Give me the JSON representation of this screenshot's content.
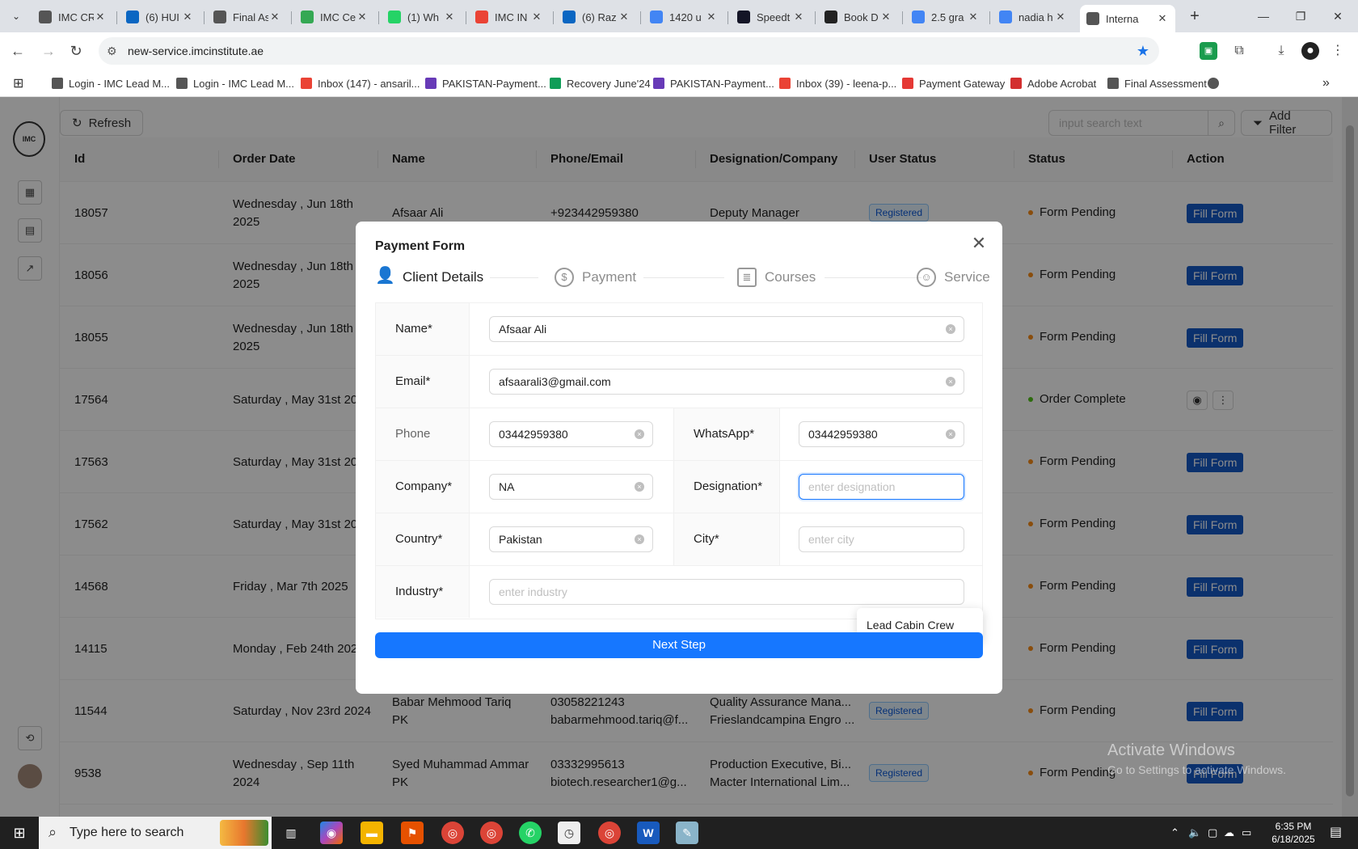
{
  "browser": {
    "tabs": [
      {
        "label": "IMC CR",
        "color": "#555555"
      },
      {
        "label": "(6) HUI",
        "color": "#0a66c2"
      },
      {
        "label": "Final As",
        "color": "#555555"
      },
      {
        "label": "IMC Ce",
        "color": "#34a853"
      },
      {
        "label": "(1) Wh",
        "color": "#25d366"
      },
      {
        "label": "IMC IN",
        "color": "#ea4335"
      },
      {
        "label": "(6) Raz",
        "color": "#0a66c2"
      },
      {
        "label": "1420 u",
        "color": "#4285f4"
      },
      {
        "label": "Speedt",
        "color": "#141526"
      },
      {
        "label": "Book D",
        "color": "#222222"
      },
      {
        "label": "2.5 gra",
        "color": "#4285f4"
      },
      {
        "label": "nadia h",
        "color": "#4285f4"
      },
      {
        "label": "Interna",
        "color": "#555555",
        "active": true
      }
    ],
    "url": "new-service.imcinstitute.ae",
    "bookmarks": [
      {
        "label": "Login - IMC Lead M...",
        "color": "#555555"
      },
      {
        "label": "Login - IMC Lead M...",
        "color": "#555555"
      },
      {
        "label": "Inbox (147) - ansaril...",
        "color": "#ea4335"
      },
      {
        "label": "PAKISTAN-Payment...",
        "color": "#673ab7"
      },
      {
        "label": "Recovery June'24",
        "color": "#0f9d58"
      },
      {
        "label": "PAKISTAN-Payment...",
        "color": "#673ab7"
      },
      {
        "label": "Inbox (39) - leena-p...",
        "color": "#ea4335"
      },
      {
        "label": "Payment Gateway",
        "color": "#e53935"
      },
      {
        "label": "Adobe Acrobat",
        "color": "#d32f2f"
      },
      {
        "label": "Final Assessment",
        "color": "#555555"
      }
    ]
  },
  "sidebar": {
    "logo_text": "IMC"
  },
  "toolbar": {
    "refresh_label": "Refresh",
    "search_placeholder": "input search text",
    "add_filter_label": "Add Filter"
  },
  "table": {
    "columns": [
      "Id",
      "Order Date",
      "Name",
      "Phone/Email",
      "Designation/Company",
      "User Status",
      "Status",
      "Action"
    ],
    "rows": [
      {
        "id": "18057",
        "date1": "Wednesday , Jun 18th",
        "date2": "2025",
        "name1": "Afsaar Ali",
        "name2": "",
        "phone": "+923442959380",
        "email": "",
        "desig": "Deputy Manager",
        "company": "",
        "user_status": "Registered",
        "status": "Form Pending",
        "action": "Fill Form"
      },
      {
        "id": "18056",
        "date1": "Wednesday , Jun 18th",
        "date2": "2025",
        "name1": "",
        "name2": "",
        "phone": "",
        "email": "",
        "desig": "",
        "company": "",
        "user_status": "",
        "status": "Form Pending",
        "action": "Fill Form"
      },
      {
        "id": "18055",
        "date1": "Wednesday , Jun 18th",
        "date2": "2025",
        "name1": "",
        "name2": "",
        "phone": "",
        "email": "",
        "desig": "",
        "company": "",
        "user_status": "",
        "status": "Form Pending",
        "action": "Fill Form"
      },
      {
        "id": "17564",
        "date1": "Saturday , May 31st 2025",
        "date2": "",
        "name1": "",
        "name2": "",
        "phone": "",
        "email": "",
        "desig": "",
        "company": "",
        "user_status": "",
        "status": "Order Complete",
        "action": ""
      },
      {
        "id": "17563",
        "date1": "Saturday , May 31st 2025",
        "date2": "",
        "name1": "",
        "name2": "",
        "phone": "",
        "email": "",
        "desig": "",
        "company": "",
        "user_status": "",
        "status": "Form Pending",
        "action": "Fill Form"
      },
      {
        "id": "17562",
        "date1": "Saturday , May 31st 2025",
        "date2": "",
        "name1": "",
        "name2": "",
        "phone": "",
        "email": "",
        "desig": "",
        "company": "",
        "user_status": "",
        "status": "Form Pending",
        "action": "Fill Form"
      },
      {
        "id": "14568",
        "date1": "Friday , Mar 7th 2025",
        "date2": "",
        "name1": "",
        "name2": "",
        "phone": "",
        "email": "",
        "desig": "",
        "company": "",
        "user_status": "",
        "status": "Form Pending",
        "action": "Fill Form"
      },
      {
        "id": "14115",
        "date1": "Monday , Feb 24th 2025",
        "date2": "",
        "name1": "",
        "name2": "",
        "phone": "",
        "email": "",
        "desig": "",
        "company": "",
        "user_status": "",
        "status": "Form Pending",
        "action": "Fill Form"
      },
      {
        "id": "11544",
        "date1": "Saturday , Nov 23rd 2024",
        "date2": "",
        "name1": "Babar Mehmood Tariq",
        "name2": "PK",
        "phone": "03058221243",
        "email": "babarmehmood.tariq@f...",
        "desig": "Quality Assurance Mana...",
        "company": "Frieslandcampina Engro ...",
        "user_status": "Registered",
        "status": "Form Pending",
        "action": "Fill Form"
      },
      {
        "id": "9538",
        "date1": "Wednesday , Sep 11th",
        "date2": "2024",
        "name1": "Syed Muhammad Ammar",
        "name2": "PK",
        "phone": "03332995613",
        "email": "biotech.researcher1@g...",
        "desig": "Production Executive, Bi...",
        "company": "Macter International Lim...",
        "user_status": "Registered",
        "status": "Form Pending",
        "action": "Fill Form"
      }
    ],
    "status_colors": {
      "Form Pending": "#fa8c16",
      "Order Complete": "#52c41a"
    }
  },
  "modal": {
    "title": "Payment Form",
    "steps": [
      "Client Details",
      "Payment",
      "Courses",
      "Service"
    ],
    "fields": {
      "name_label": "Name*",
      "name_value": "Afsaar Ali",
      "email_label": "Email*",
      "email_value": "afsaarali3@gmail.com",
      "phone_label": "Phone",
      "phone_value": "03442959380",
      "whatsapp_label": "WhatsApp*",
      "whatsapp_value": "03442959380",
      "company_label": "Company*",
      "company_value": "NA",
      "designation_label": "Designation*",
      "designation_placeholder": "enter designation",
      "country_label": "Country*",
      "country_value": "Pakistan",
      "city_label": "City*",
      "city_placeholder": "enter city",
      "industry_label": "Industry*",
      "industry_placeholder": "enter industry"
    },
    "suggestion": "Lead Cabin Crew",
    "next_label": "Next Step"
  },
  "watermark": {
    "line1": "Activate Windows",
    "line2": "Go to Settings to activate Windows."
  },
  "taskbar": {
    "search_placeholder": "Type here to search",
    "time": "6:35 PM",
    "date": "6/18/2025"
  }
}
